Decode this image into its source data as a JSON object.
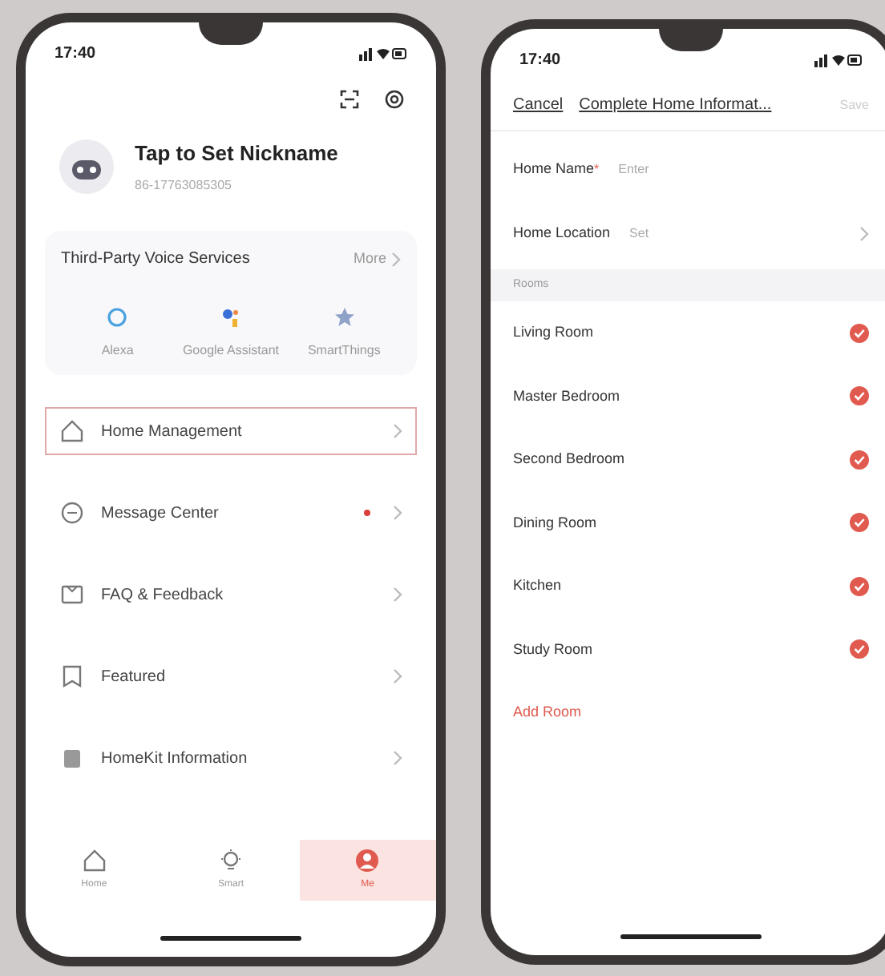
{
  "left_phone": {
    "status_time": "17:40",
    "profile": {
      "nickname": "Tap to Set Nickname",
      "account": "86-17763085305"
    },
    "voice_services": {
      "title": "Third-Party Voice Services",
      "more": "More",
      "items": [
        {
          "label": "Alexa",
          "kind": "ring"
        },
        {
          "label": "Google Assistant",
          "kind": "dots"
        },
        {
          "label": "SmartThings",
          "kind": "star"
        }
      ]
    },
    "menu": [
      {
        "label": "Home Management",
        "kind": "house",
        "selected": true,
        "unread": false
      },
      {
        "label": "Message Center",
        "kind": "clock",
        "selected": false,
        "unread": true
      },
      {
        "label": "FAQ & Feedback",
        "kind": "book",
        "selected": false,
        "unread": false
      },
      {
        "label": "Featured",
        "kind": "bookmark",
        "selected": false,
        "unread": false
      },
      {
        "label": "HomeKit Information",
        "kind": "kit",
        "selected": false,
        "unread": false
      }
    ],
    "tab_bar": [
      {
        "label": "Home",
        "kind": "house",
        "selected": false
      },
      {
        "label": "Smart",
        "kind": "bulb",
        "selected": false
      },
      {
        "label": "Me",
        "kind": "person",
        "selected": true
      }
    ]
  },
  "right_phone": {
    "status_time": "17:40",
    "nav": {
      "cancel": "Cancel",
      "title": "Complete Home Informat...",
      "save": "Save",
      "save_disabled": true
    },
    "fields": [
      {
        "label": "Home Name",
        "marker": "*",
        "value_hint": "Enter",
        "chevron": false
      },
      {
        "label": "Home Location",
        "value_hint": "Set",
        "chevron": true
      }
    ],
    "rooms_header": "Rooms",
    "rooms": [
      {
        "name": "Living Room",
        "checked": true
      },
      {
        "name": "Master Bedroom",
        "checked": true
      },
      {
        "name": "Second Bedroom",
        "checked": true
      },
      {
        "name": "Dining Room",
        "checked": true
      },
      {
        "name": "Kitchen",
        "checked": true
      },
      {
        "name": "Study Room",
        "checked": true
      }
    ],
    "add_room": "Add Room"
  }
}
